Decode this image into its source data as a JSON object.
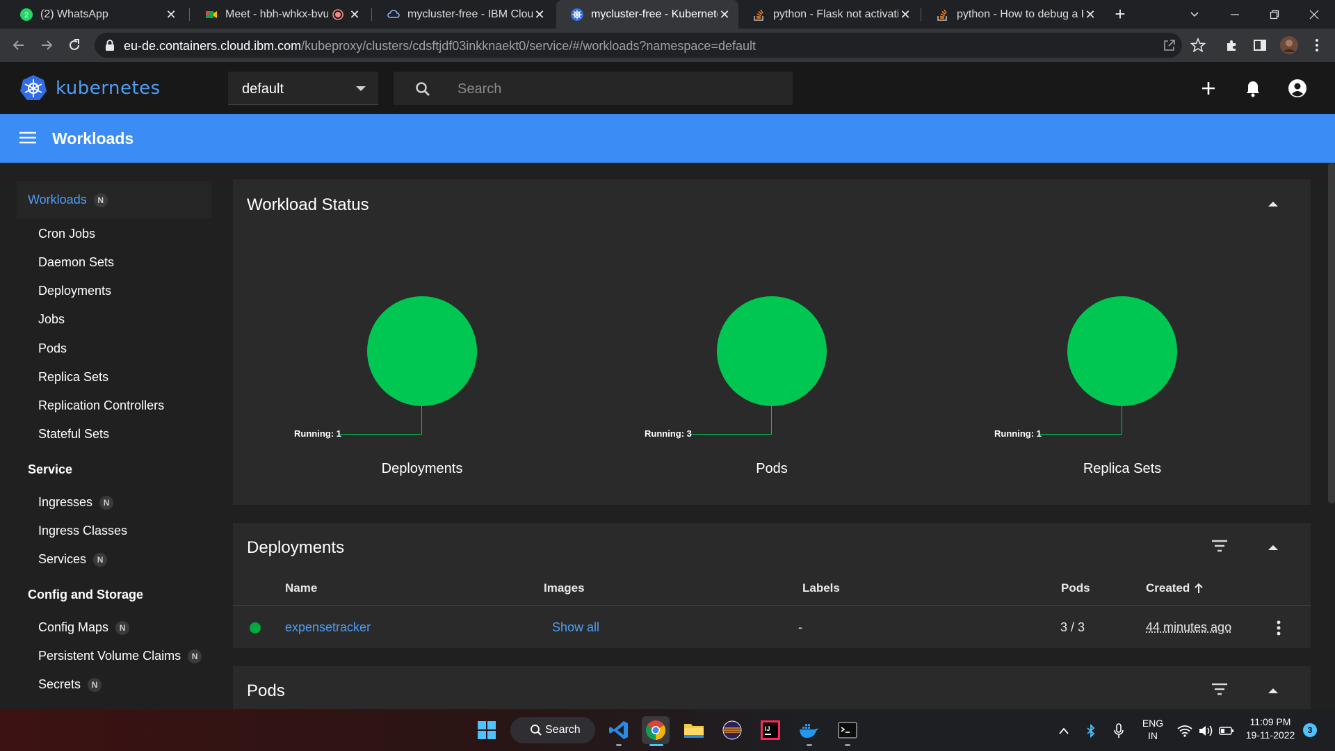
{
  "browser": {
    "tabs": [
      {
        "title": "(2) WhatsApp",
        "icon": "whatsapp-icon"
      },
      {
        "title": "Meet - hbh-whkx-bvu",
        "icon": "google-meet-icon"
      },
      {
        "title": "mycluster-free - IBM Cloud",
        "icon": "ibm-cloud-icon"
      },
      {
        "title": "mycluster-free - Kubernetes",
        "icon": "kubernetes-icon"
      },
      {
        "title": "python - Flask not activating",
        "icon": "stackoverflow-icon"
      },
      {
        "title": "python - How to debug a F",
        "icon": "stackoverflow-icon"
      }
    ],
    "url_host": "eu-de.containers.cloud.ibm.com",
    "url_path": "/kubeproxy/clusters/cdsftjdf03inkknaekt0/service/#/workloads?namespace=default"
  },
  "header": {
    "brand": "kubernetes",
    "namespace": "default",
    "search_placeholder": "Search"
  },
  "page": {
    "title": "Workloads"
  },
  "sidebar": {
    "workloads_label": "Workloads",
    "workloads_badge": "N",
    "workload_items": [
      "Cron Jobs",
      "Daemon Sets",
      "Deployments",
      "Jobs",
      "Pods",
      "Replica Sets",
      "Replication Controllers",
      "Stateful Sets"
    ],
    "service_section": "Service",
    "service_items": [
      {
        "label": "Ingresses",
        "badge": "N"
      },
      {
        "label": "Ingress Classes",
        "badge": ""
      },
      {
        "label": "Services",
        "badge": "N"
      }
    ],
    "config_section": "Config and Storage",
    "config_items": [
      {
        "label": "Config Maps",
        "badge": "N"
      },
      {
        "label": "Persistent Volume Claims",
        "badge": "N"
      },
      {
        "label": "Secrets",
        "badge": "N"
      }
    ]
  },
  "workload_status": {
    "title": "Workload Status",
    "charts": [
      {
        "label": "Deployments",
        "running_text": "Running: 1",
        "running": 1
      },
      {
        "label": "Pods",
        "running_text": "Running: 3",
        "running": 3
      },
      {
        "label": "Replica Sets",
        "running_text": "Running: 1",
        "running": 1
      }
    ],
    "running_color": "#00c752"
  },
  "deployments": {
    "title": "Deployments",
    "columns": {
      "name": "Name",
      "images": "Images",
      "labels": "Labels",
      "pods": "Pods",
      "created": "Created"
    },
    "rows": [
      {
        "name": "expensetracker",
        "images": "Show all",
        "labels": "-",
        "pods": "3 / 3",
        "created": "44 minutes ago",
        "status_color": "#00a83e"
      }
    ]
  },
  "pods": {
    "title": "Pods"
  },
  "taskbar": {
    "search_label": "Search",
    "language_top": "ENG",
    "language_bottom": "IN",
    "time": "11:09 PM",
    "date": "19-11-2022",
    "notification_count": "3"
  },
  "colors": {
    "accent": "#3b8cf5",
    "link": "#4f9df5",
    "running": "#00c752"
  }
}
